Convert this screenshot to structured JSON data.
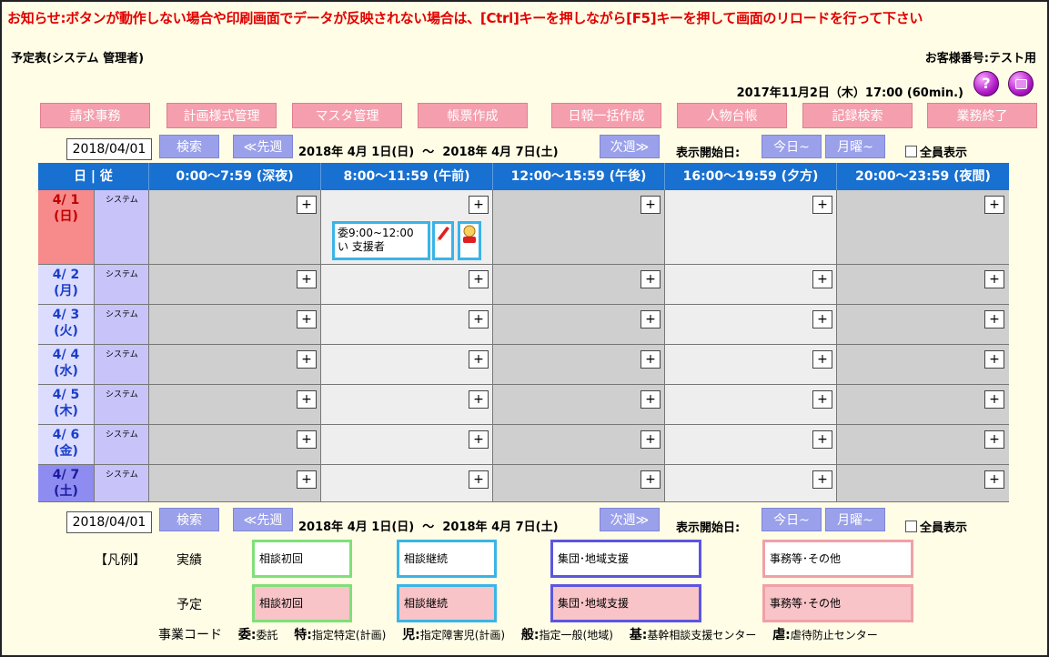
{
  "notice": "お知らせ:ボタンが動作しない場合や印刷画面でデータが反映されない場合は、[Ctrl]キーを押しながら[F5]キーを押して画面のリロードを行って下さい",
  "title": "予定表(システム 管理者)",
  "customer": "お客様番号:テスト用",
  "datetime": "2017年11月2日（木）17:00 (60min.)",
  "icons": {
    "help": "help-icon",
    "print": "print-icon"
  },
  "menu": [
    {
      "label": "請求事務"
    },
    {
      "label": "計画様式管理"
    },
    {
      "label": "マスタ管理"
    },
    {
      "label": "帳票作成"
    },
    {
      "label": "日報一括作成"
    },
    {
      "label": "人物台帳"
    },
    {
      "label": "記録検索"
    },
    {
      "label": "業務終了"
    }
  ],
  "nav": {
    "date": "2018/04/01",
    "search": "検索",
    "prev": "≪先週",
    "range_start": "2018年 4月 1日(日)",
    "tilde": "～",
    "range_end": "2018年 4月 7日(土)",
    "next": "次週≫",
    "start_label": "表示開始日:",
    "today": "今日~",
    "monday": "月曜~",
    "show_all": "全員表示"
  },
  "grid": {
    "header": {
      "day": "日 | 従",
      "slots": [
        "0:00～7:59 (深夜)",
        "8:00～11:59 (午前)",
        "12:00～15:59 (午後)",
        "16:00～19:59 (夕方)",
        "20:00～23:59 (夜間)"
      ]
    },
    "plus": "+",
    "rows": [
      {
        "date": "4/ 1",
        "dow": "(日)",
        "staff": "システム"
      },
      {
        "date": "4/ 2",
        "dow": "(月)",
        "staff": "システム"
      },
      {
        "date": "4/ 3",
        "dow": "(火)",
        "staff": "システム"
      },
      {
        "date": "4/ 4",
        "dow": "(水)",
        "staff": "システム"
      },
      {
        "date": "4/ 5",
        "dow": "(木)",
        "staff": "システム"
      },
      {
        "date": "4/ 6",
        "dow": "(金)",
        "staff": "システム"
      },
      {
        "date": "4/ 7",
        "dow": "(土)",
        "staff": "システム"
      }
    ],
    "event": {
      "line1": "委9:00~12:00",
      "line2": "い 支援者",
      "edit_icon": "pencil-icon",
      "person_icon": "person-icon"
    }
  },
  "legend": {
    "label": "【凡例】",
    "actual": "実績",
    "planned": "予定",
    "items": [
      "相談初回",
      "相談継続",
      "集団･地域支援",
      "事務等･その他"
    ],
    "colors": {
      "green": "#7fe07a",
      "cyan": "#3ab4e8",
      "indigo": "#5c55e0",
      "pink": "#f0a0a8",
      "planned_bg": "#f9c4c8"
    }
  },
  "codes": {
    "label": "事業コード",
    "items": [
      {
        "k": "委:",
        "v": "委託"
      },
      {
        "k": "特:",
        "v": "指定特定(計画)"
      },
      {
        "k": "児:",
        "v": "指定障害児(計画)"
      },
      {
        "k": "般:",
        "v": "指定一般(地域)"
      },
      {
        "k": "基:",
        "v": "基幹相談支援センター"
      },
      {
        "k": "虐:",
        "v": "虐待防止センター"
      }
    ]
  },
  "colors": {
    "accent_blue": "#1870d0",
    "menu_pink": "#f59fae",
    "nav_btn": "#9aa0ea",
    "notice_red": "#e00000",
    "sunday_bg": "#f78a8a",
    "saturday_bg": "#8e8cf0",
    "staff_bg": "#c8c4fa",
    "row_gray": "#cfcfcf"
  }
}
